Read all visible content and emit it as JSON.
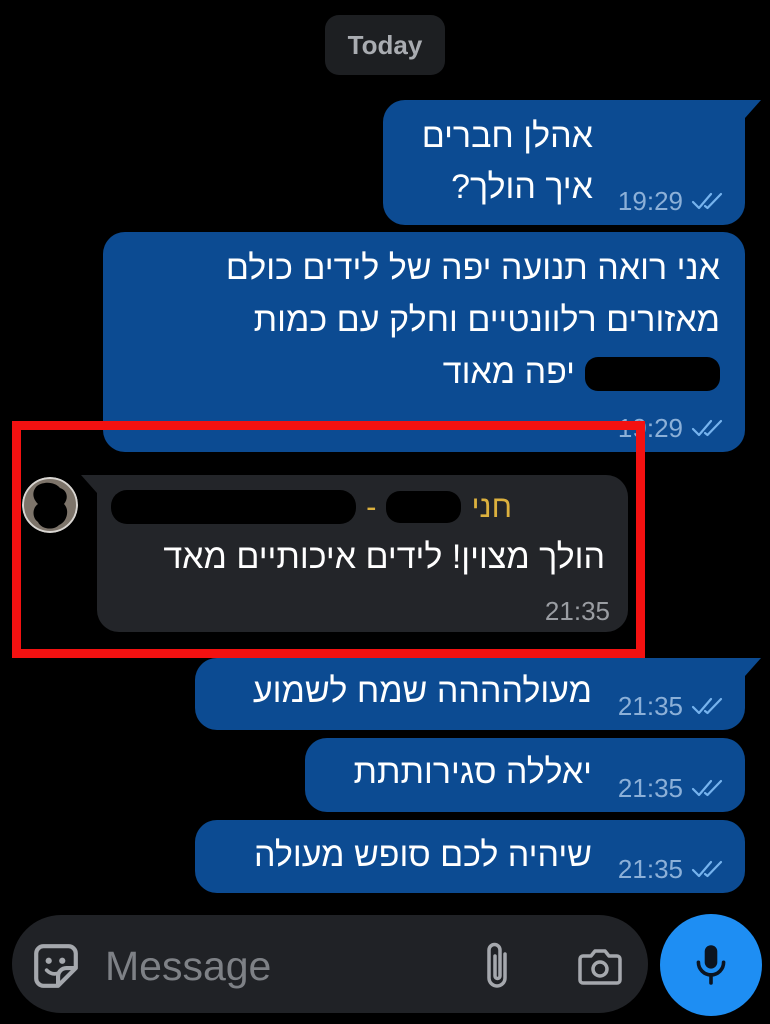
{
  "date_separator": {
    "label": "Today"
  },
  "messages": [
    {
      "outgoing": true,
      "lines": [
        "אהלן חברים",
        "איך הולך?"
      ],
      "time": "19:29",
      "status_icon": "double-check-icon"
    },
    {
      "outgoing": true,
      "lines": [
        "אני רואה תנועה יפה של לידים כולם",
        "מאזורים רלוונטיים וחלק עם כמות",
        "יפה מאוד"
      ],
      "time": "19:29",
      "status_icon": "double-check-icon"
    },
    {
      "outgoing": false,
      "sender": {
        "name": "חני",
        "separator": "-"
      },
      "lines": [
        "הולך מצוין! לידים איכותיים מאד"
      ],
      "time": "21:35"
    },
    {
      "outgoing": true,
      "lines": [
        "מעולהההה שמח לשמוע"
      ],
      "time": "21:35",
      "status_icon": "double-check-icon"
    },
    {
      "outgoing": true,
      "lines": [
        "יאללה סגירותתת"
      ],
      "time": "21:35",
      "status_icon": "double-check-icon"
    },
    {
      "outgoing": true,
      "lines": [
        "שיהיה לכם סופש מעולה"
      ],
      "time": "21:35",
      "status_icon": "double-check-icon"
    }
  ],
  "composer": {
    "placeholder": "Message",
    "left_icon": "sticker-icon",
    "right_icons": [
      "paperclip-icon",
      "camera-icon"
    ],
    "record_icon": "microphone-icon"
  },
  "colors": {
    "background": "#000000",
    "outgoing_bubble": "#0c4b92",
    "incoming_bubble": "#232529",
    "sender_name": "#dcb13e",
    "read_checks": "#76b3ee",
    "accent_button": "#1e8ef3",
    "annotation_box": "#f31111"
  }
}
